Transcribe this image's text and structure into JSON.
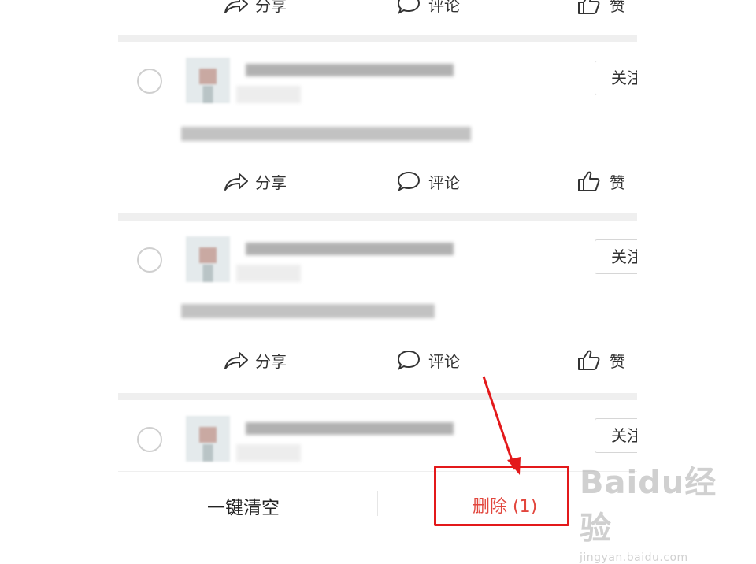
{
  "actions": {
    "share_label": "分享",
    "comment_label": "评论",
    "like_label": "赞"
  },
  "cards": [
    {
      "follow_label": "关注"
    },
    {
      "follow_label": "关注"
    },
    {
      "follow_label": "关注"
    }
  ],
  "bottom_bar": {
    "clear_all_label": "一键清空",
    "delete_label": "删除 (1)"
  },
  "annotation": {
    "highlight_color": "#e3191b"
  },
  "watermark": {
    "logo_text": "Baidu经验",
    "url_text": "jingyan.baidu.com"
  },
  "colors": {
    "delete_red": "#e2463d",
    "divider_gray": "#efefef"
  }
}
